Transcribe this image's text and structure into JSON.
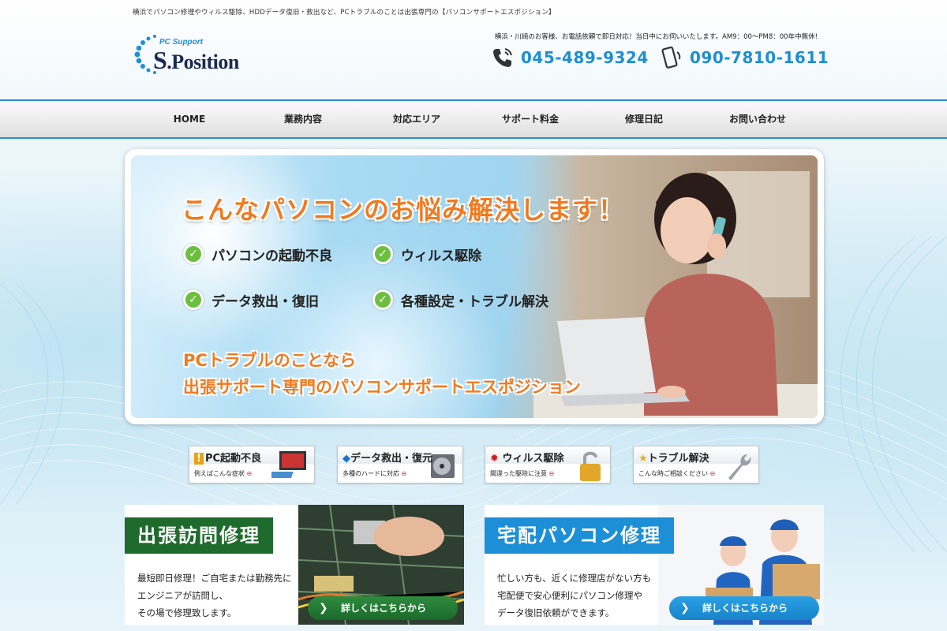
{
  "header": {
    "tagline": "横浜でパソコン修理やウィルス駆除、HDDデータ復旧・救出など、PCトラブルのことは出張専門の【パソコンサポートエスポジション】",
    "logo_sub": "PC Support",
    "logo_main_s": "S",
    "logo_main_rest": ".Position",
    "contact_note": "横浜・川崎のお客様、お電話依頼で即日対応！当日中にお伺いいたします。AM9：00〜PM8：00年中無休!",
    "phone1": "045-489-9324",
    "phone2": "090-7810-1611"
  },
  "nav": {
    "items": [
      "HOME",
      "業務内容",
      "対応エリア",
      "サポート料金",
      "修理日記",
      "お問い合わせ"
    ]
  },
  "hero": {
    "title": "こんなパソコンのお悩み解決します！",
    "checks": [
      "パソコンの起動不良",
      "ウィルス駆除",
      "データ救出・復旧",
      "各種設定・トラブル解決"
    ],
    "sub1": "PCトラブルのことなら",
    "sub2": "出張サポート専門のパソコンサポートエスポジション"
  },
  "mini_banners": [
    {
      "title": "PC起動不良",
      "sub": "例えばこんな症状"
    },
    {
      "title": "データ救出・復元",
      "sub": "多種のハードに対応"
    },
    {
      "title": "ウィルス駆除",
      "sub": "間違った駆除に注意"
    },
    {
      "title": "トラブル解決",
      "sub": "こんな時ご相談ください"
    }
  ],
  "services": {
    "visit": {
      "heading": "出張訪問修理",
      "line1": "最短即日修理！ご自宅または勤務先に",
      "line2": "エンジニアが訪問し、",
      "line3": "その場で修理致します。",
      "button": "詳しくはこちらから"
    },
    "delivery": {
      "heading": "宅配パソコン修理",
      "line1": "忙しい方も、近くに修理店がない方も",
      "line2": "宅配便で安心便利にパソコン修理や",
      "line3": "データ復旧依頼ができます。",
      "button": "詳しくはこちらから"
    }
  },
  "colors": {
    "accent_blue": "#1d8fd2",
    "accent_orange": "#f07a20",
    "accent_green": "#1f6b2e"
  }
}
